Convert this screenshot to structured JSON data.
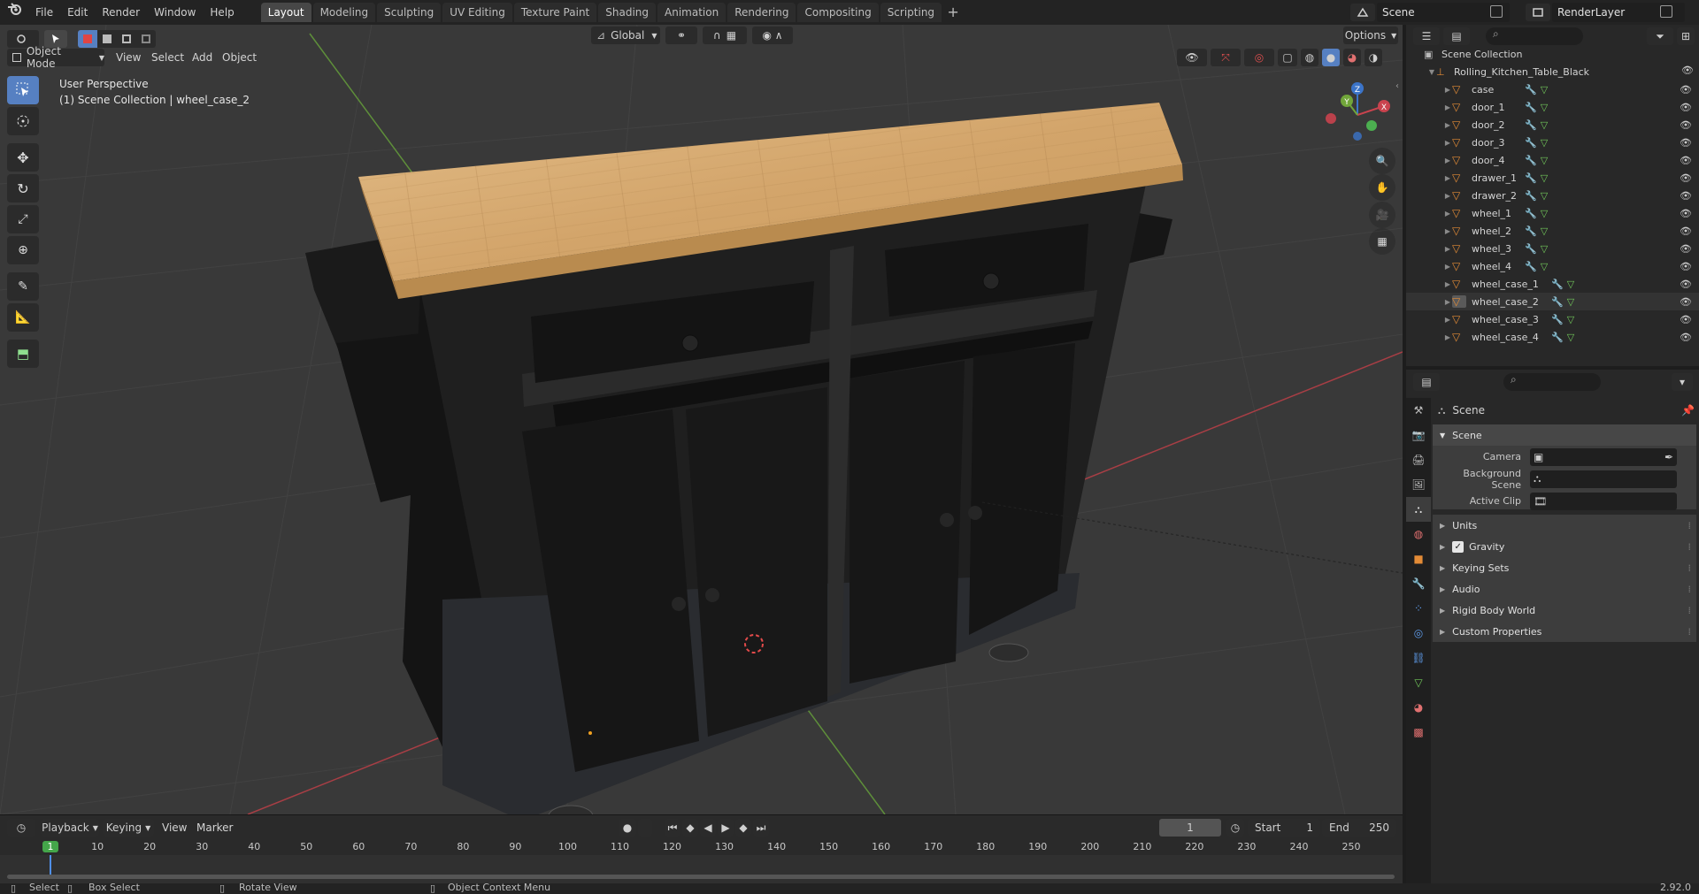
{
  "menu": {
    "items": [
      "File",
      "Edit",
      "Render",
      "Window",
      "Help"
    ]
  },
  "workspaces": {
    "tabs": [
      "Layout",
      "Modeling",
      "Sculpting",
      "UV Editing",
      "Texture Paint",
      "Shading",
      "Animation",
      "Rendering",
      "Compositing",
      "Scripting"
    ],
    "active": "Layout",
    "add": "+"
  },
  "scene_selector": {
    "value": "Scene"
  },
  "view_layer_selector": {
    "value": "RenderLayer"
  },
  "viewport_header": {
    "mode": "Object Mode",
    "menus": [
      "View",
      "Select",
      "Add",
      "Object"
    ],
    "transform_orientation": "Global",
    "options": "Options"
  },
  "viewport": {
    "perspective_label": "User Perspective",
    "context_label": "(1) Scene Collection | wheel_case_2",
    "gizmo": {
      "x": "X",
      "y": "Y",
      "z": "Z"
    }
  },
  "outliner": {
    "root": "Scene Collection",
    "collection": "Rolling_Kitchen_Table_Black",
    "objects": [
      "case",
      "door_1",
      "door_2",
      "door_3",
      "door_4",
      "drawer_1",
      "drawer_2",
      "wheel_1",
      "wheel_2",
      "wheel_3",
      "wheel_4",
      "wheel_case_1",
      "wheel_case_2",
      "wheel_case_3",
      "wheel_case_4"
    ],
    "selected": "wheel_case_2"
  },
  "properties": {
    "header": "Scene",
    "panel_title": "Scene",
    "fields": [
      {
        "label": "Camera",
        "value": ""
      },
      {
        "label": "Background Scene",
        "value": ""
      },
      {
        "label": "Active Clip",
        "value": ""
      }
    ],
    "subpanels": [
      "Units",
      "Gravity",
      "Keying Sets",
      "Audio",
      "Rigid Body World",
      "Custom Properties"
    ],
    "gravity_checked": true
  },
  "timeline": {
    "menus": [
      "Playback",
      "Keying",
      "View",
      "Marker"
    ],
    "current_frame": "1",
    "start_label": "Start",
    "start": "1",
    "end_label": "End",
    "end": "250",
    "ruler": [
      "1",
      "10",
      "20",
      "30",
      "40",
      "50",
      "60",
      "70",
      "80",
      "90",
      "100",
      "110",
      "120",
      "130",
      "140",
      "150",
      "160",
      "170",
      "180",
      "190",
      "200",
      "210",
      "220",
      "230",
      "240",
      "250"
    ]
  },
  "statusbar": {
    "select": "Select",
    "box_select": "Box Select",
    "rotate_view": "Rotate View",
    "context_menu": "Object Context Menu",
    "version": "2.92.0"
  },
  "colors": {
    "accent": "#5680c2",
    "active_tab": "#474747",
    "frame_marker": "#44a64a",
    "x_axis": "#c9434e",
    "y_axis": "#71a63a",
    "z_axis": "#3b74c9",
    "object_orange": "#e38b36"
  }
}
